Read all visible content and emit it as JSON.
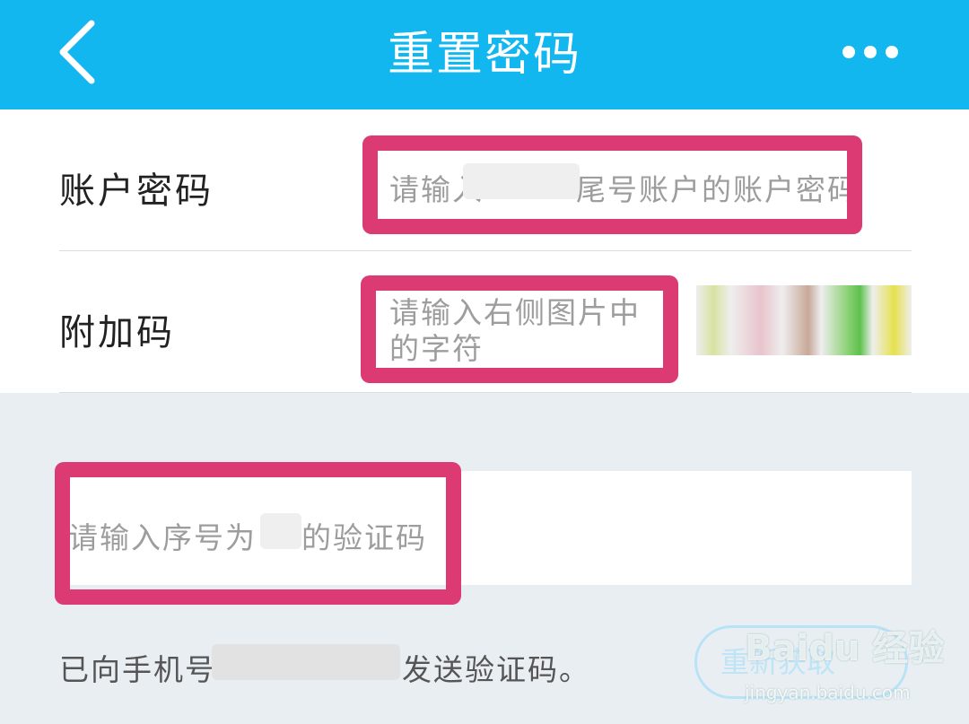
{
  "header": {
    "title": "重置密码",
    "background": "#12b7ef",
    "back_icon": "chevron-left-icon",
    "more_icon": "more-dots-icon"
  },
  "form": {
    "account_password": {
      "label": "账户密码",
      "placeholder_start": "请输入",
      "placeholder_end": "尾号账户的账户密码"
    },
    "extra_code": {
      "label": "附加码",
      "placeholder_line1": "请输入右侧图片中",
      "placeholder_line2": "的字符"
    },
    "sms_code": {
      "placeholder_start": "请输入序号为",
      "placeholder_end": "的验证码"
    }
  },
  "notice": {
    "prefix": "已向手机号",
    "suffix": "发送验证码。"
  },
  "resend_button": {
    "label": "重新获取"
  },
  "watermark": {
    "brand": "Baidu 经验",
    "url": "jingyan.baidu.com"
  },
  "highlight_color": "#dc3a72"
}
